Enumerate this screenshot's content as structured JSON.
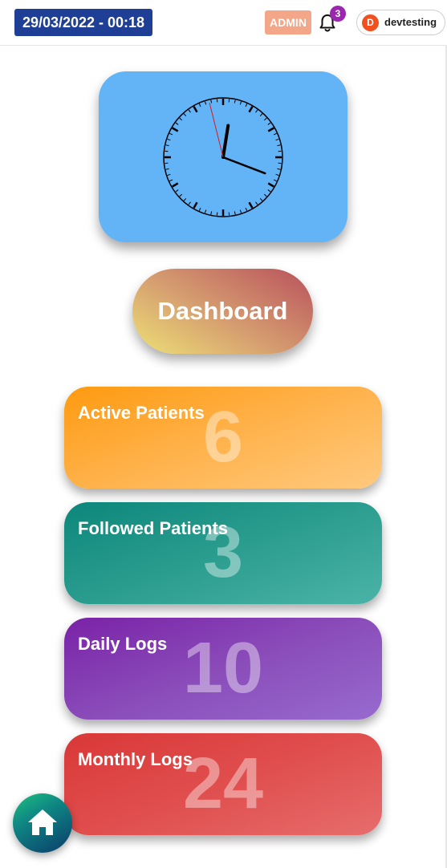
{
  "header": {
    "datetime": "29/03/2022 - 00:18",
    "role_badge": "ADMIN",
    "notifications_count": "3",
    "user_initial": "D",
    "username": "devtesting"
  },
  "clock": {
    "time_shown": "00:18",
    "hour_hand_degrees": 9,
    "minute_hand_degrees": 111,
    "second_hand_degrees": 346
  },
  "dashboard_title": "Dashboard",
  "stats": [
    {
      "label": "Active Patients",
      "value": "6"
    },
    {
      "label": "Followed Patients",
      "value": "3"
    },
    {
      "label": "Daily Logs",
      "value": "10"
    },
    {
      "label": "Monthly Logs",
      "value": "24"
    }
  ],
  "icons": {
    "notifications": "bell-icon",
    "home": "home-icon"
  },
  "colors": {
    "datetime_bg": "#1e3f95",
    "admin_badge_bg": "#f4a688",
    "notification_badge": "#9b27b0",
    "avatar_bg": "#f2511f",
    "clock_card_bg": "#63b3f7",
    "active_patients": "#fe9a10",
    "followed_patients": "#0c877b",
    "daily_logs": "#7a22a7",
    "monthly_logs": "#d93837"
  }
}
